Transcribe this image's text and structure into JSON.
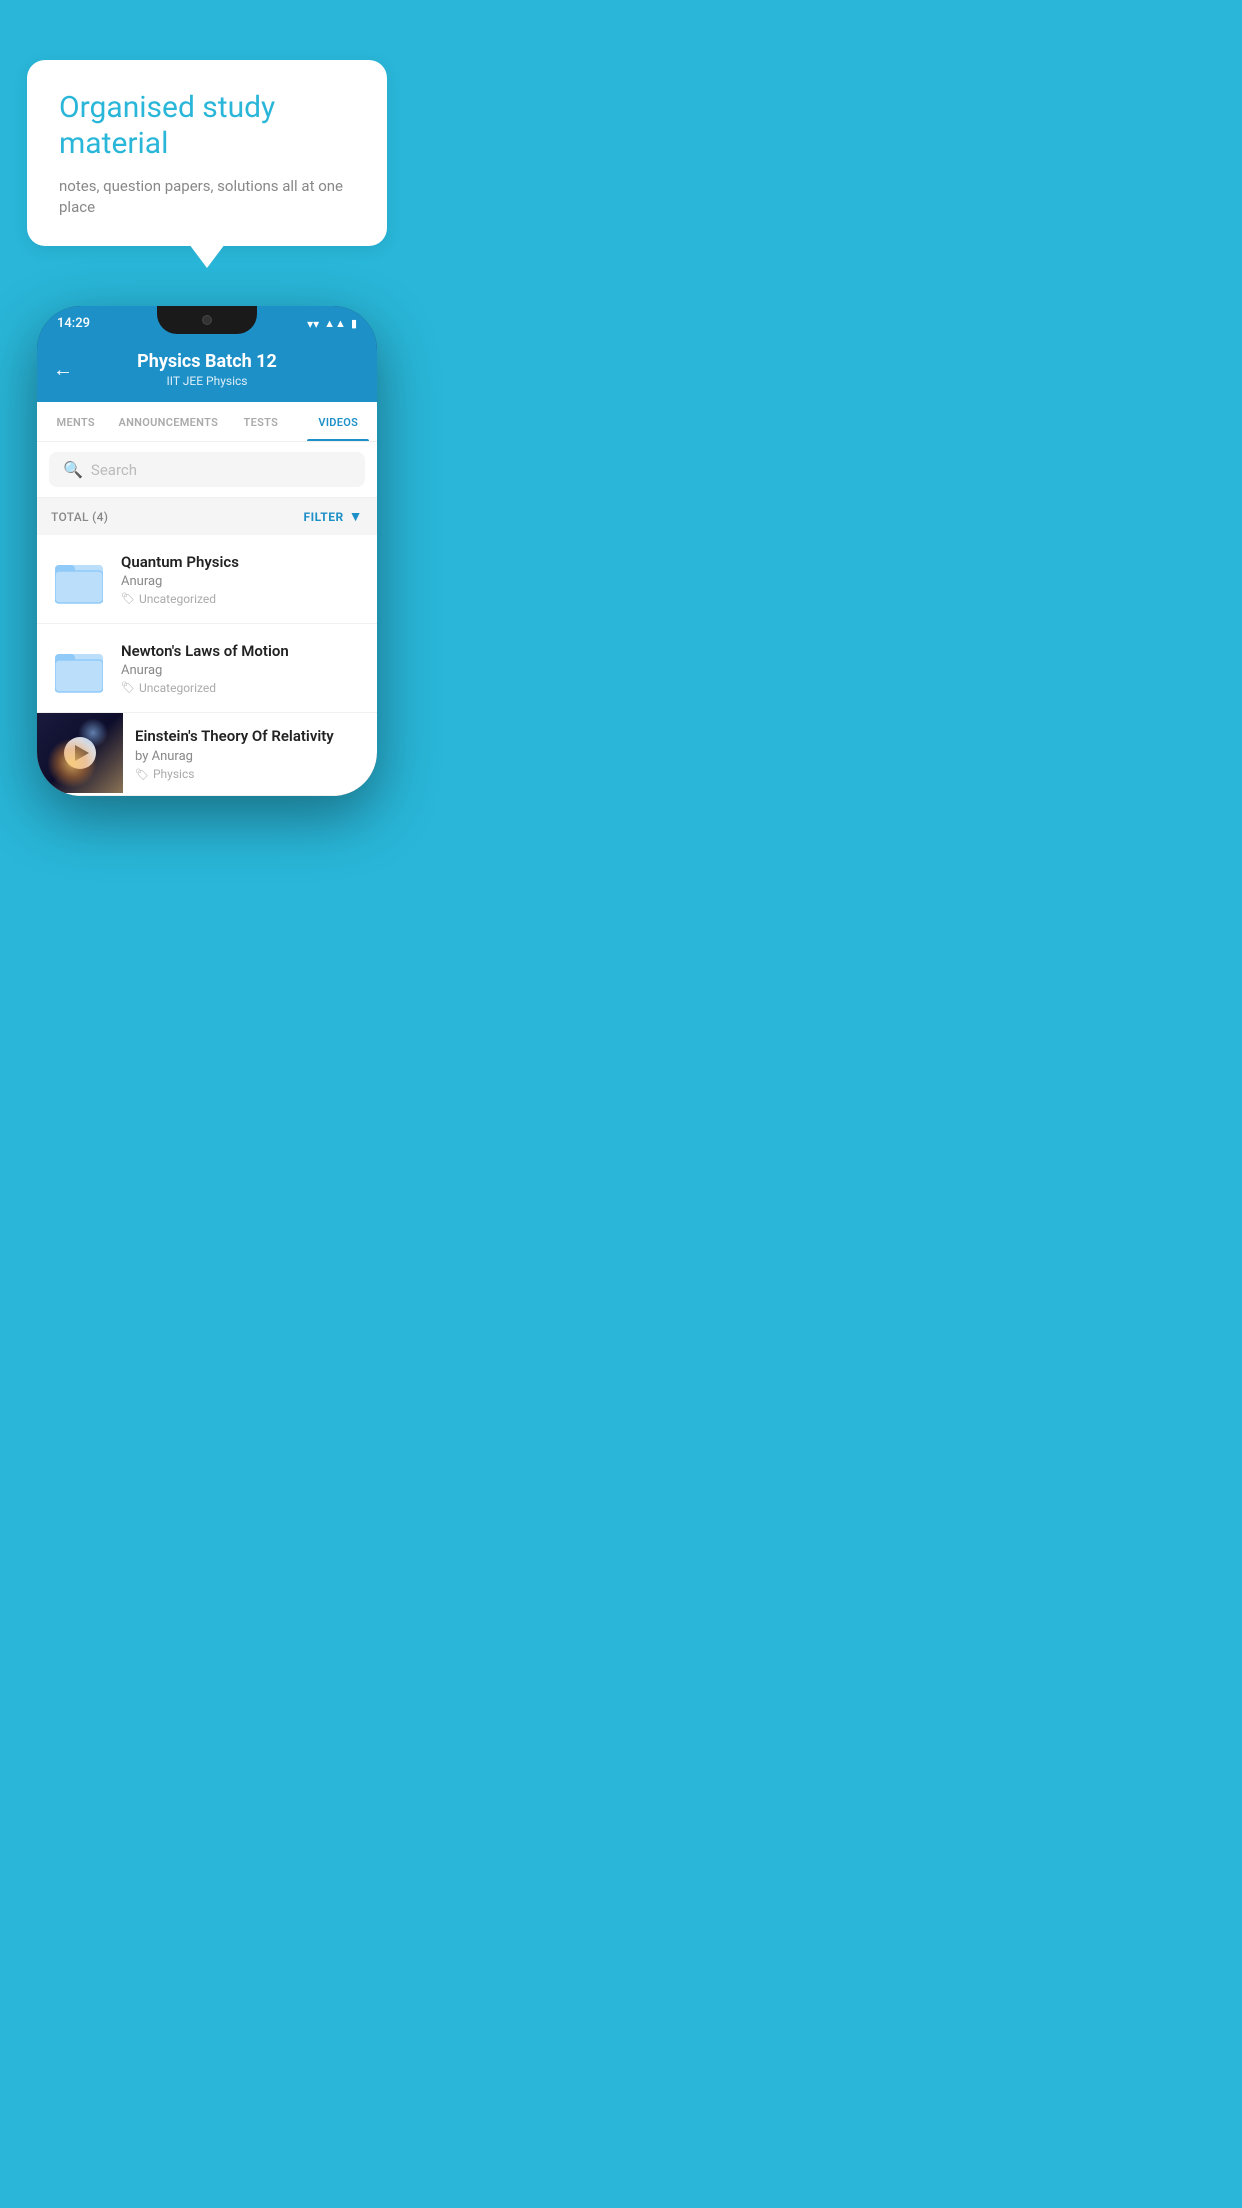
{
  "hero": {
    "bubble_title": "Organised study material",
    "bubble_subtitle": "notes, question papers, solutions all at one place"
  },
  "phone": {
    "status_time": "14:29",
    "header": {
      "title": "Physics Batch 12",
      "subtitle": "IIT JEE   Physics",
      "back_label": "←"
    },
    "tabs": [
      {
        "label": "MENTS",
        "active": false
      },
      {
        "label": "ANNOUNCEMENTS",
        "active": false
      },
      {
        "label": "TESTS",
        "active": false
      },
      {
        "label": "VIDEOS",
        "active": true
      }
    ],
    "search": {
      "placeholder": "Search"
    },
    "filter": {
      "total_label": "TOTAL (4)",
      "filter_label": "FILTER"
    },
    "videos": [
      {
        "title": "Quantum Physics",
        "author": "Anurag",
        "tag": "Uncategorized",
        "has_thumb": false
      },
      {
        "title": "Newton's Laws of Motion",
        "author": "Anurag",
        "tag": "Uncategorized",
        "has_thumb": false
      },
      {
        "title": "Einstein's Theory Of Relativity",
        "author": "by Anurag",
        "tag": "Physics",
        "has_thumb": true
      }
    ]
  }
}
